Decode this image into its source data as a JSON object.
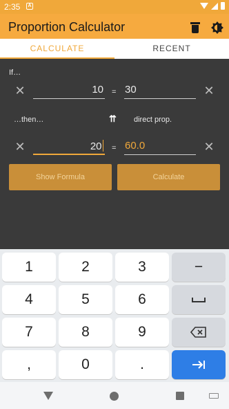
{
  "status_bar": {
    "time": "2:35",
    "notification_badge": "A"
  },
  "app_bar": {
    "title": "Proportion Calculator",
    "icons": [
      "trash-icon",
      "theme-icon"
    ]
  },
  "tabs": [
    {
      "label": "CALCULATE",
      "selected": true
    },
    {
      "label": "RECENT",
      "selected": false
    }
  ],
  "form": {
    "if_label": "If…",
    "row1": {
      "left_value": "10",
      "equals": "=",
      "right_value": "30"
    },
    "then_label": "…then…",
    "relation_label": "direct prop.",
    "row2": {
      "left_value": "20",
      "equals": "=",
      "right_value": "60.0"
    }
  },
  "buttons": {
    "show_formula": "Show Formula",
    "calculate": "Calculate"
  },
  "keyboard": {
    "rows": [
      [
        "1",
        "2",
        "3",
        "−"
      ],
      [
        "4",
        "5",
        "6",
        "␣"
      ],
      [
        "7",
        "8",
        "9",
        "⌫"
      ],
      [
        ",",
        "0",
        ".",
        "⇥"
      ]
    ]
  },
  "colors": {
    "accent": "#f6aa3f",
    "background": "#3a3a3a",
    "button": "#c98f39",
    "key_blue": "#2e7ee6"
  }
}
